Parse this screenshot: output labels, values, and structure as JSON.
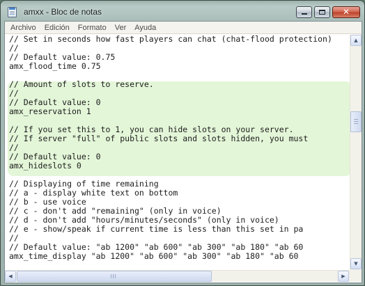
{
  "window": {
    "title": "amxx - Bloc de notas",
    "icon": "notepad-icon",
    "close_glyph": "✕"
  },
  "menu": {
    "items": [
      "Archivo",
      "Edición",
      "Formato",
      "Ver",
      "Ayuda"
    ]
  },
  "editor": {
    "lines": [
      "// Set in seconds how fast players can chat (chat-flood protection)",
      "//",
      "// Default value: 0.75",
      "amx_flood_time 0.75",
      "",
      "// Amount of slots to reserve.",
      "//",
      "// Default value: 0",
      "amx_reservation 1",
      "",
      "// If you set this to 1, you can hide slots on your server.",
      "// If server \"full\" of public slots and slots hidden, you must",
      "//",
      "// Default value: 0",
      "amx_hideslots 0",
      "",
      "// Displaying of time remaining",
      "// a - display white text on bottom",
      "// b - use voice",
      "// c - don't add \"remaining\" (only in voice)",
      "// d - don't add \"hours/minutes/seconds\" (only in voice)",
      "// e - show/speak if current time is less than this set in pa",
      "//",
      "// Default value: \"ab 1200\" \"ab 600\" \"ab 300\" \"ab 180\" \"ab 60",
      "amx_time_display \"ab 1200\" \"ab 600\" \"ab 300\" \"ab 180\" \"ab 60"
    ],
    "highlight_color": "#e3f6d8"
  },
  "scrollbars": {
    "up": "▲",
    "down": "▼",
    "left": "◀",
    "right": "▶"
  }
}
